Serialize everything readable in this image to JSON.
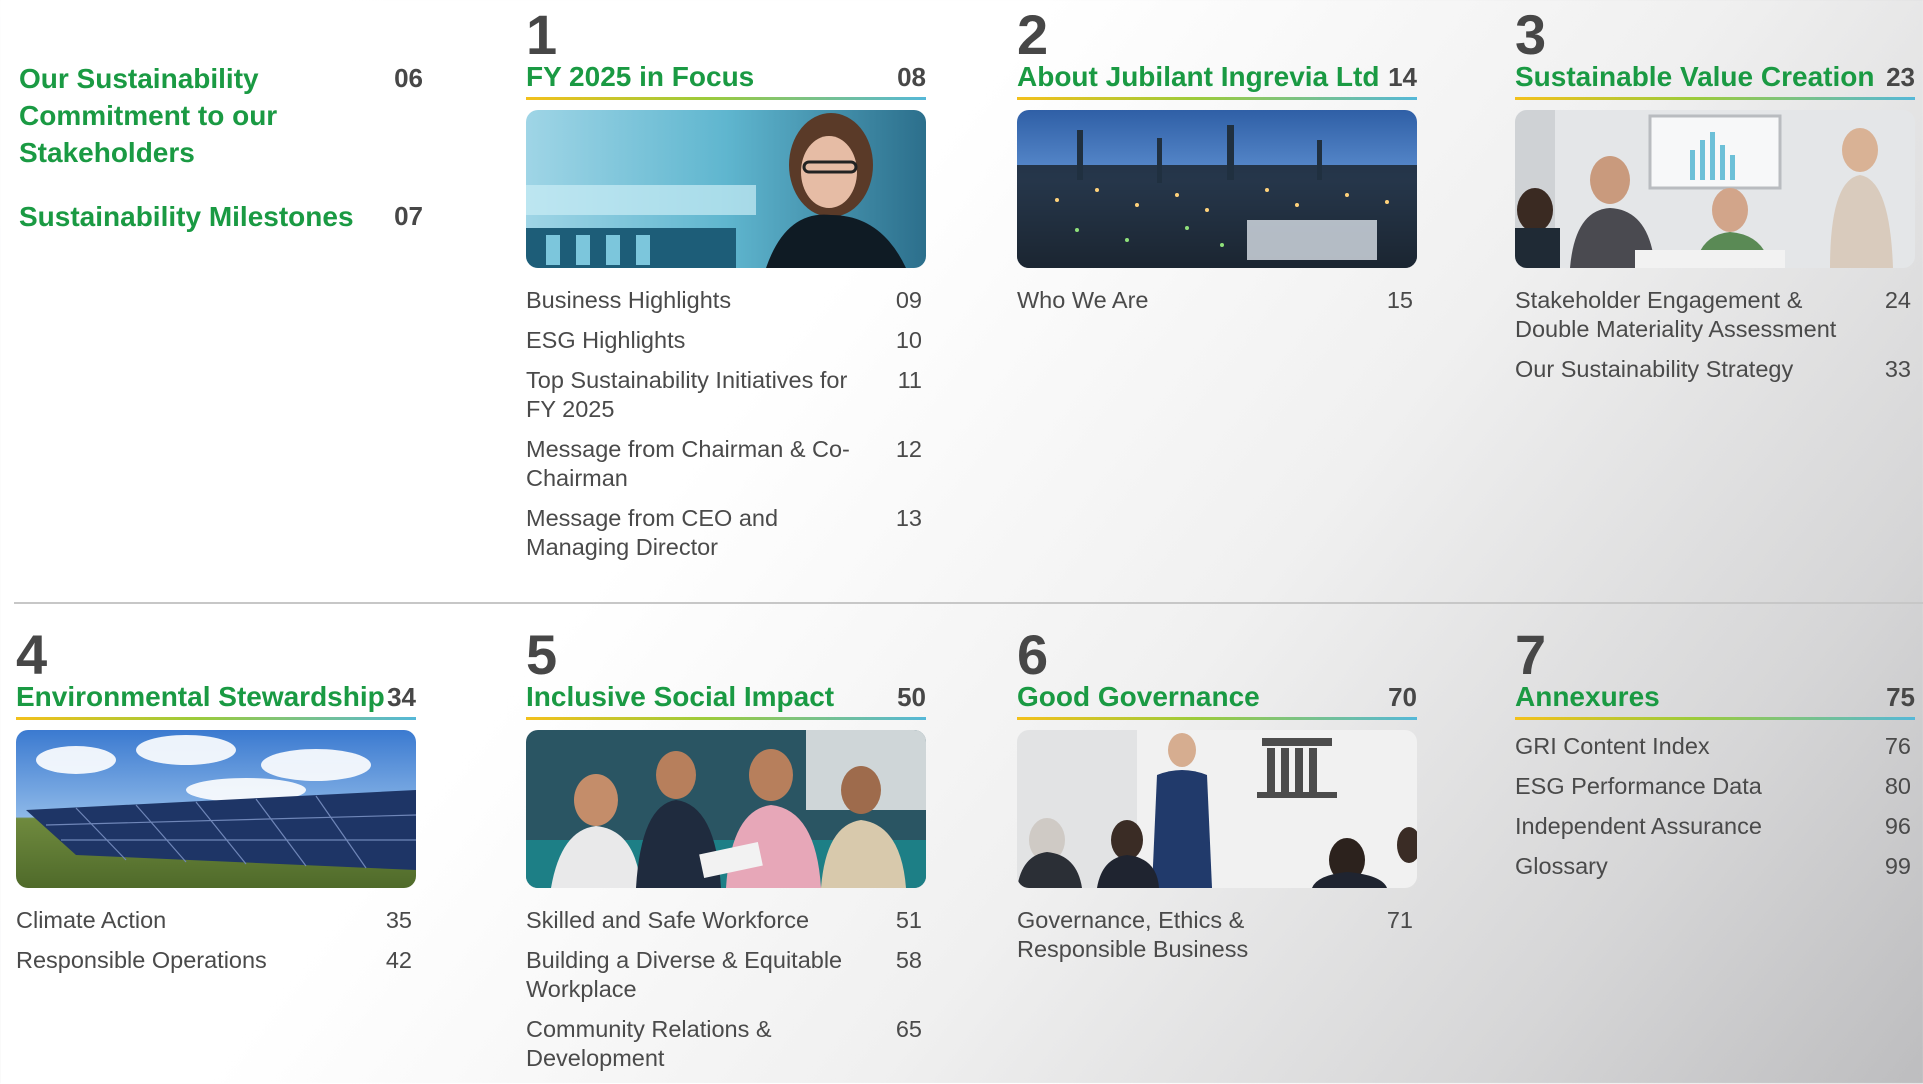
{
  "intro": [
    {
      "title": "Our Sustainability Commitment to our Stakeholders",
      "page": "06"
    },
    {
      "title": "Sustainability Milestones",
      "page": "07"
    }
  ],
  "sections": [
    {
      "number": "1",
      "title": "FY 2025 in Focus",
      "page": "08",
      "image": "woman-at-desk-photo",
      "items": [
        {
          "label": "Business Highlights",
          "page": "09"
        },
        {
          "label": "ESG Highlights",
          "page": "10"
        },
        {
          "label": "Top Sustainability Initiatives for FY 2025",
          "page": "11"
        },
        {
          "label": "Message from Chairman & Co-Chairman",
          "page": "12"
        },
        {
          "label": "Message from CEO and Managing Director",
          "page": "13"
        }
      ]
    },
    {
      "number": "2",
      "title": "About Jubilant Ingrevia Ltd",
      "page": "14",
      "image": "industrial-plant-night-photo",
      "items": [
        {
          "label": "Who We Are",
          "page": "15"
        }
      ]
    },
    {
      "number": "3",
      "title": "Sustainable Value Creation",
      "page": "23",
      "image": "meeting-room-photo",
      "items": [
        {
          "label": "Stakeholder Engagement & Double Materiality Assessment",
          "page": "24"
        },
        {
          "label": "Our Sustainability Strategy",
          "page": "33"
        }
      ]
    },
    {
      "number": "4",
      "title": "Environmental Stewardship",
      "page": "34",
      "image": "solar-panels-photo",
      "items": [
        {
          "label": "Climate Action",
          "page": "35"
        },
        {
          "label": "Responsible Operations",
          "page": "42"
        }
      ]
    },
    {
      "number": "5",
      "title": "Inclusive Social Impact",
      "page": "50",
      "image": "team-collaboration-photo",
      "items": [
        {
          "label": "Skilled and Safe Workforce",
          "page": "51"
        },
        {
          "label": "Building a Diverse & Equitable Workplace",
          "page": "58"
        },
        {
          "label": "Community Relations & Development",
          "page": "65"
        }
      ]
    },
    {
      "number": "6",
      "title": "Good Governance",
      "page": "70",
      "image": "boardroom-presentation-photo",
      "items": [
        {
          "label": "Governance, Ethics & Responsible Business",
          "page": "71"
        }
      ]
    },
    {
      "number": "7",
      "title": "Annexures",
      "page": "75",
      "image": "",
      "items": [
        {
          "label": "GRI Content Index",
          "page": "76"
        },
        {
          "label": "ESG Performance Data",
          "page": "80"
        },
        {
          "label": "Independent Assurance",
          "page": "96"
        },
        {
          "label": "Glossary",
          "page": "99"
        }
      ]
    }
  ],
  "colors": {
    "accent_green": "#1a9a43",
    "text_dark": "#474747",
    "rule_yellow": "#f3c01b",
    "rule_blue": "#55b8d8"
  }
}
